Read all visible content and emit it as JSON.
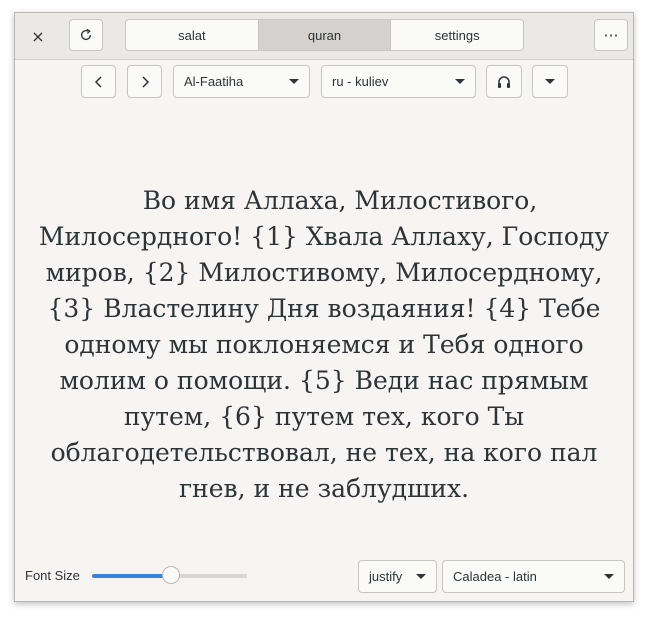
{
  "header": {
    "close_icon": "×",
    "refresh_icon": "refresh-icon",
    "tabs": [
      {
        "label": "salat"
      },
      {
        "label": "quran"
      },
      {
        "label": "settings"
      }
    ],
    "active_tab": "quran",
    "menu_icon": "⋯"
  },
  "toolbar": {
    "prev_icon": "chevron-left-icon",
    "next_icon": "chevron-right-icon",
    "surah": "Al-Faatiha",
    "translation": "ru - kuliev",
    "audio_icon": "headphones-icon",
    "more_icon": "chevron-down-icon"
  },
  "content": {
    "verse_text": "Во имя Аллаха, Милостивого, Милосердного! {1} Хвала Аллаху, Господу миров, {2} Милостивому, Милосердному, {3} Властелину Дня воздаяния! {4} Тебе одному мы поклоняемся и Тебя одного молим о помощи. {5} Веди нас прямым путем, {6} путем тех, кого Ты облагодетельствовал, не тех, на кого пал гнев, и не заблудших."
  },
  "footer": {
    "font_size_label": "Font Size",
    "font_size_level": 0.51,
    "alignment": "justify",
    "font": "Caladea - latin"
  },
  "colors": {
    "accent": "#3584e4",
    "text": "#2e3436",
    "window_bg": "#f6f5f4"
  }
}
